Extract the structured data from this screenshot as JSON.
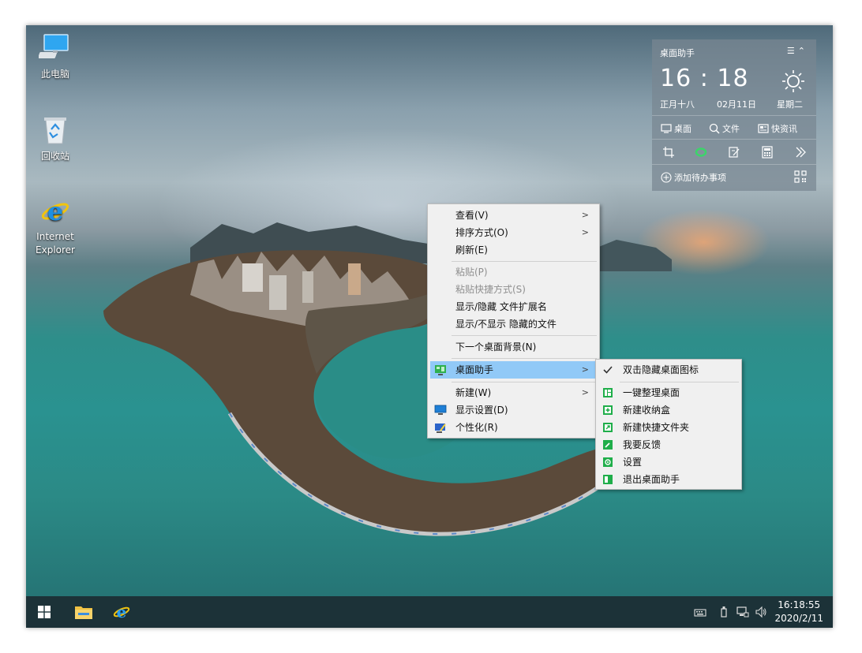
{
  "desktop": {
    "icons": [
      {
        "label": "此电脑"
      },
      {
        "label": "回收站"
      },
      {
        "label": "Internet\nExplorer"
      }
    ]
  },
  "widget": {
    "title": "桌面助手",
    "time": "16 : 18",
    "lunar_date": "正月十八",
    "date": "02月11日",
    "weekday": "星期二",
    "buttons": {
      "desktop": "桌面",
      "files": "文件",
      "news": "快资讯"
    },
    "add_todo": "添加待办事项"
  },
  "context_menu": {
    "items": [
      {
        "label": "查看(V)",
        "submenu": true
      },
      {
        "label": "排序方式(O)",
        "submenu": true
      },
      {
        "label": "刷新(E)"
      },
      {
        "label": "粘贴(P)",
        "disabled": true
      },
      {
        "label": "粘贴快捷方式(S)",
        "disabled": true
      },
      {
        "label": "显示/隐藏 文件扩展名"
      },
      {
        "label": "显示/不显示 隐藏的文件"
      },
      {
        "label": "下一个桌面背景(N)"
      },
      {
        "label": "桌面助手",
        "submenu": true,
        "highlighted": true
      },
      {
        "label": "新建(W)",
        "submenu": true
      },
      {
        "label": "显示设置(D)"
      },
      {
        "label": "个性化(R)"
      }
    ]
  },
  "submenu": {
    "items": [
      {
        "label": "双击隐藏桌面图标",
        "checked": true
      },
      {
        "label": "一键整理桌面"
      },
      {
        "label": "新建收纳盒"
      },
      {
        "label": "新建快捷文件夹"
      },
      {
        "label": "我要反馈"
      },
      {
        "label": "设置"
      },
      {
        "label": "退出桌面助手"
      }
    ]
  },
  "taskbar": {
    "time": "16:18:55",
    "date": "2020/2/11"
  },
  "colors": {
    "menu_highlight": "#91c9f7",
    "submenu_icon_green": "#1fae4a",
    "taskbar": "#1c2e34"
  }
}
